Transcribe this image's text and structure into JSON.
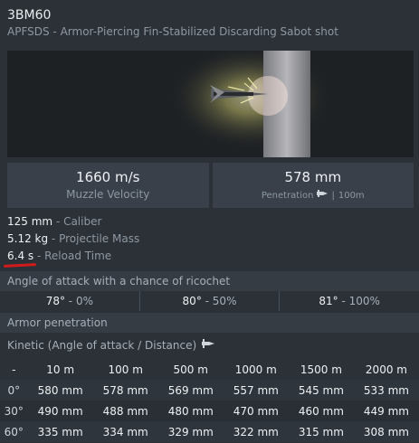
{
  "header": {
    "title": "3BM60",
    "subtitle": "APFSDS - Armor-Piercing Fin-Stabilized Discarding Sabot shot"
  },
  "stats": {
    "velocity_value": "1660 m/s",
    "velocity_label": "Muzzle Velocity",
    "penetration_value": "578 mm",
    "penetration_label": "Penetration",
    "penetration_range": "100m"
  },
  "properties": [
    {
      "value": "125 mm",
      "label": "Caliber"
    },
    {
      "value": "5.12 kg",
      "label": "Projectile Mass"
    },
    {
      "value": "6.4 s",
      "label": "Reload Time"
    }
  ],
  "ricochet": {
    "title": "Angle of attack with a chance of ricochet",
    "items": [
      {
        "angle": "78°",
        "pct": "0%"
      },
      {
        "angle": "80°",
        "pct": "50%"
      },
      {
        "angle": "81°",
        "pct": "100%"
      }
    ]
  },
  "armor": {
    "title": "Armor penetration",
    "kinetic_label": "Kinetic (Angle of attack / Distance)",
    "columns": [
      "-",
      "10 m",
      "100 m",
      "500 m",
      "1000 m",
      "1500 m",
      "2000 m"
    ],
    "rows": [
      {
        "angle": "0°",
        "values": [
          "580 mm",
          "578 mm",
          "569 mm",
          "557 mm",
          "545 mm",
          "533 mm"
        ]
      },
      {
        "angle": "30°",
        "values": [
          "490 mm",
          "488 mm",
          "480 mm",
          "470 mm",
          "460 mm",
          "449 mm"
        ]
      },
      {
        "angle": "60°",
        "values": [
          "335 mm",
          "334 mm",
          "329 mm",
          "322 mm",
          "315 mm",
          "308 mm"
        ]
      }
    ]
  },
  "icons": {
    "shell": "shell-icon",
    "hero": "projectile-impact-illustration"
  },
  "colors": {
    "accent_underline": "#d21a1a"
  }
}
